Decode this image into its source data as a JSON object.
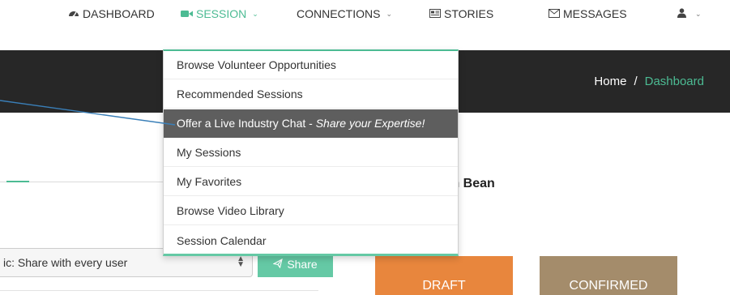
{
  "nav": {
    "dashboard": {
      "label": "DASHBOARD",
      "icon": "dashboard-icon"
    },
    "session": {
      "label": "SESSION",
      "icon": "video-camera-icon",
      "active": true
    },
    "connections": {
      "label": "CONNECTIONS"
    },
    "stories": {
      "label": "STORIES",
      "icon": "newspaper-icon"
    },
    "messages": {
      "label": "MESSAGES",
      "icon": "envelope-icon"
    },
    "user": {
      "icon": "user-icon"
    }
  },
  "breadcrumb": {
    "home": "Home",
    "separator": "/",
    "current": "Dashboard"
  },
  "session_menu": {
    "items": [
      {
        "label": "Browse Volunteer Opportunities"
      },
      {
        "label": "Recommended Sessions"
      },
      {
        "label": "Offer a Live Industry Chat - ",
        "emphasis": "Share your Expertise!",
        "highlighted": true
      },
      {
        "label": "My Sessions"
      },
      {
        "label": "My Favorites"
      },
      {
        "label": "Browse Video Library"
      },
      {
        "label": "Session Calendar"
      }
    ]
  },
  "welcome": {
    "name_fragment": "m Bean"
  },
  "composer": {
    "visibility_value": "ic: Share with every user",
    "share_label": "Share"
  },
  "status_cards": {
    "draft": "DRAFT",
    "confirmed": "CONFIRMED"
  },
  "colors": {
    "accent": "#4cbb93",
    "header_bg": "#272727",
    "menu_highlight": "#5e5e5e",
    "draft": "#e8863d",
    "confirmed": "#a48c6b",
    "annotation_line": "#3a7fb8"
  }
}
